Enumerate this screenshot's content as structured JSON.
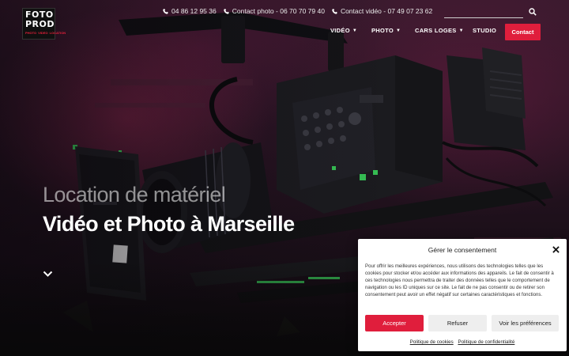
{
  "header": {
    "logo": {
      "line1": "FOTO",
      "line2": "PROD",
      "tagline": [
        "PHOTO",
        "VIDEO",
        "LOCATION"
      ]
    },
    "contacts": [
      {
        "icon": "phone-icon",
        "label": "04 86 12 95 36"
      },
      {
        "icon": "phone-icon",
        "label": "Contact photo - 06 70 70 79 40"
      },
      {
        "icon": "phone-icon",
        "label": "Contact vidéo - 07 49 07 23 62"
      }
    ],
    "search": {
      "icon": "search-icon",
      "placeholder": ""
    },
    "nav": [
      {
        "label": "VIDÉO",
        "has_dropdown": true
      },
      {
        "label": "PHOTO",
        "has_dropdown": true
      },
      {
        "label": "CARS LOGES",
        "has_dropdown": true
      },
      {
        "label": "STUDIO",
        "has_dropdown": false
      }
    ],
    "contact_button": "Contact"
  },
  "hero": {
    "subtitle": "Location de matériel",
    "title": "Vidéo et Photo à Marseille",
    "scroll_icon": "chevron-down-icon"
  },
  "cookie_banner": {
    "title": "Gérer le consentement",
    "text": "Pour offrir les meilleures expériences, nous utilisons des technologies telles que les cookies pour stocker et/ou accéder aux informations des appareils. Le fait de consentir à ces technologies nous permettra de traiter des données telles que le comportement de navigation ou les ID uniques sur ce site. Le fait de ne pas consentir ou de retirer son consentement peut avoir un effet négatif sur certaines caractéristiques et fonctions.",
    "buttons": {
      "accept": "Accepter",
      "refuse": "Refuser",
      "preferences": "Voir les préférences"
    },
    "links": {
      "cookies": "Politique de cookies",
      "privacy": "Politique de confidentialité"
    }
  },
  "colors": {
    "accent": "#e01e3c",
    "hero_bg": "#2a1424",
    "modal_bg": "#ffffff"
  }
}
